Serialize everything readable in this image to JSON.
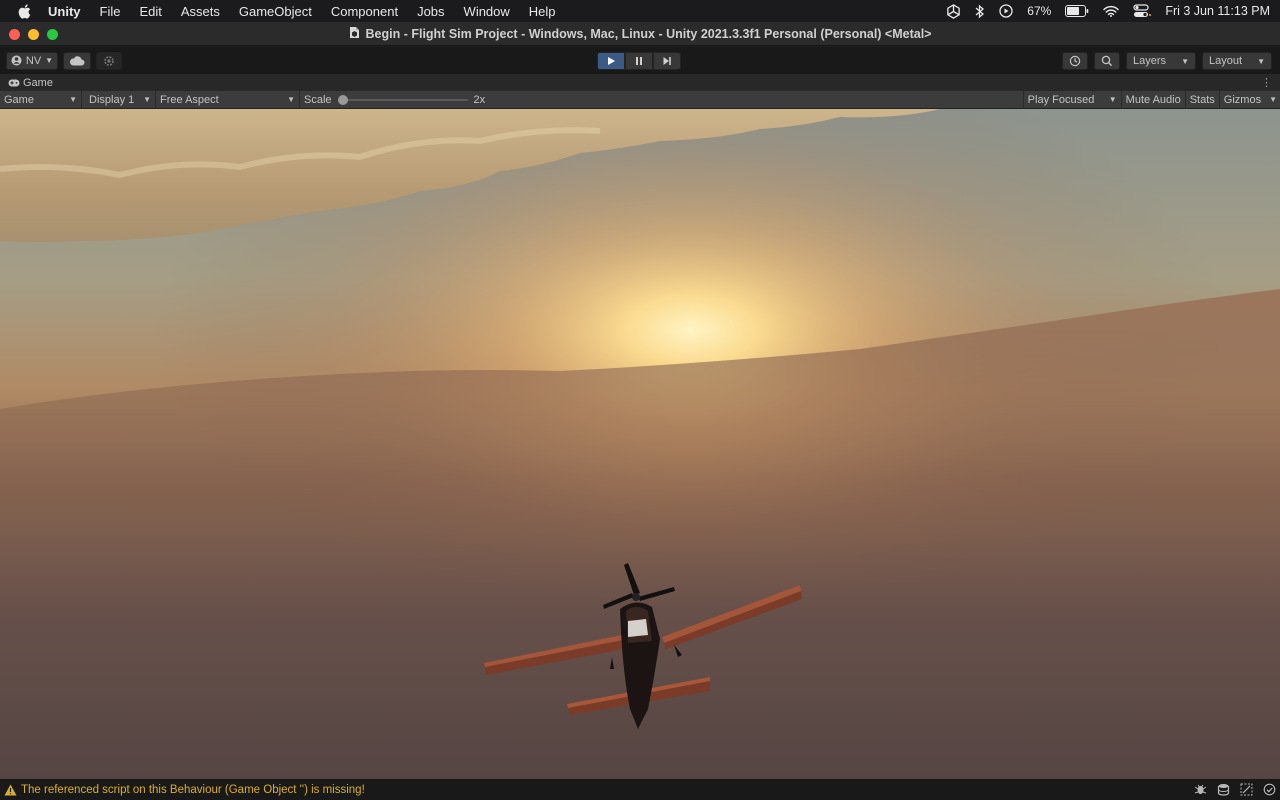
{
  "menubar": {
    "app_name": "Unity",
    "items": [
      "File",
      "Edit",
      "Assets",
      "GameObject",
      "Component",
      "Jobs",
      "Window",
      "Help"
    ],
    "battery": "67%",
    "clock": "Fri 3 Jun  11:13 PM"
  },
  "window": {
    "title": "Begin - Flight Sim Project - Windows, Mac, Linux - Unity 2021.3.3f1 Personal (Personal) <Metal>"
  },
  "toolbar": {
    "account_label": "NV",
    "layers_label": "Layers",
    "layout_label": "Layout"
  },
  "tab": {
    "label": "Game"
  },
  "gamebar": {
    "view_mode": "Game",
    "display": "Display 1",
    "aspect": "Free Aspect",
    "scale_label": "Scale",
    "scale_value": "2x",
    "scale_level": 0,
    "play_mode": "Play Focused",
    "mute_audio": "Mute Audio",
    "stats": "Stats",
    "gizmos": "Gizmos"
  },
  "status": {
    "message": "The referenced script on this Behaviour (Game Object '<Missing Prefab with guid: ...>') is missing!",
    "message_visible": "The referenced script on this Behaviour (Game Object '') is missing!"
  },
  "colors": {
    "play_active": "#3b5a86",
    "warning": "#dcae2e",
    "sky_top": "#8e948f",
    "sun": "#ffe9a6"
  },
  "icons": {
    "apple": "apple-icon",
    "unity": "unity-icon",
    "bluetooth": "bluetooth-icon",
    "wifi": "wifi-icon",
    "battery": "battery-icon",
    "control_center": "control-center-icon",
    "play": "play-icon",
    "pause": "pause-icon",
    "step": "step-icon",
    "warning": "warning-icon"
  }
}
